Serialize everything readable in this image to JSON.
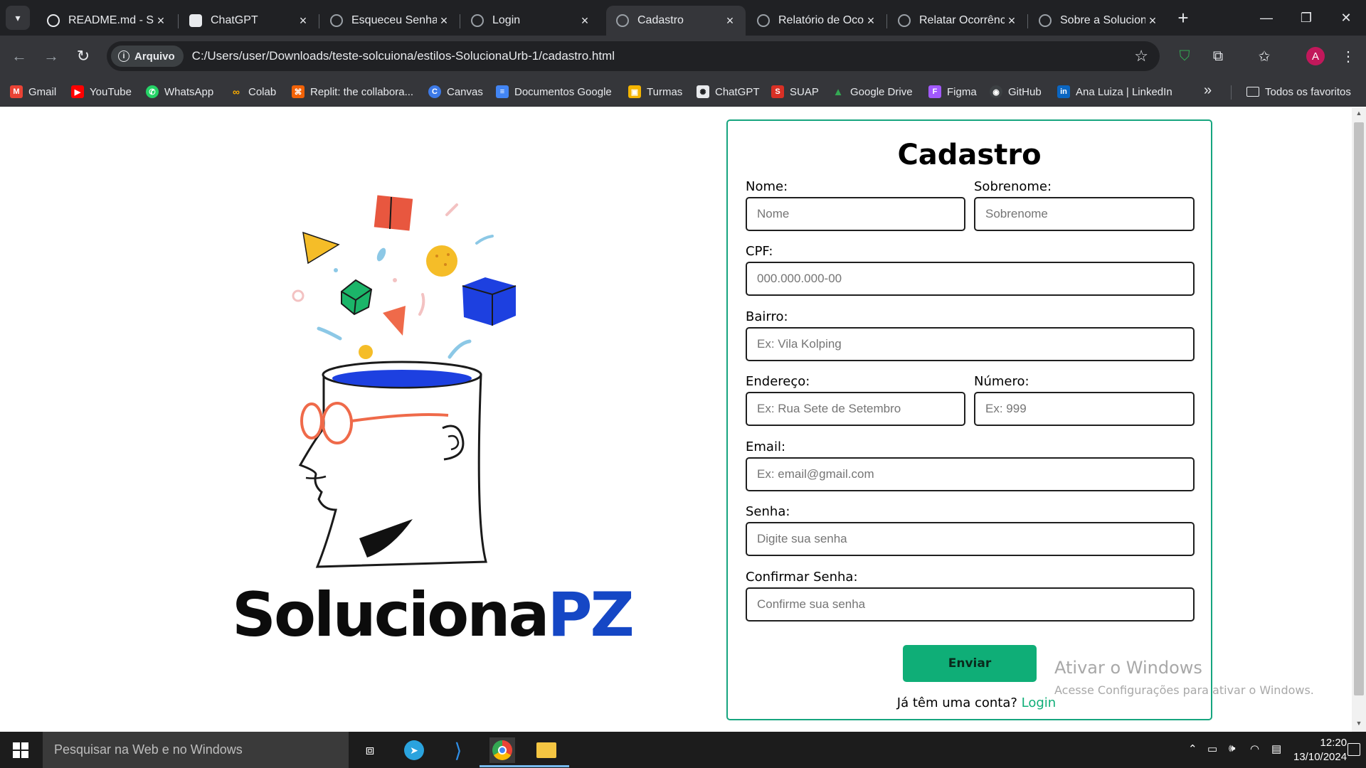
{
  "browser": {
    "tabs": [
      {
        "title": "README.md - Sc",
        "icon": "github-icon"
      },
      {
        "title": "ChatGPT",
        "icon": "chatgpt-icon"
      },
      {
        "title": "Esqueceu Senha",
        "icon": "globe-icon"
      },
      {
        "title": "Login",
        "icon": "globe-icon"
      },
      {
        "title": "Cadastro",
        "icon": "globe-icon",
        "active": true
      },
      {
        "title": "Relatório de Oco",
        "icon": "globe-icon"
      },
      {
        "title": "Relatar Ocorrênc",
        "icon": "globe-icon"
      },
      {
        "title": "Sobre a Solucion",
        "icon": "globe-icon"
      }
    ],
    "security_chip": "Arquivo",
    "url": "C:/Users/user/Downloads/teste-solcuiona/estilos-SolucionaUrb-1/cadastro.html",
    "profile_initial": "A",
    "bookmarks": [
      {
        "label": "Gmail",
        "icon": "gmail-icon",
        "color": "#ea4335"
      },
      {
        "label": "YouTube",
        "icon": "youtube-icon",
        "color": "#ff0000"
      },
      {
        "label": "WhatsApp",
        "icon": "whatsapp-icon",
        "color": "#25d366"
      },
      {
        "label": "Colab",
        "icon": "colab-icon",
        "color": "#f9ab00"
      },
      {
        "label": "Replit: the collabora...",
        "icon": "replit-icon",
        "color": "#f26207"
      },
      {
        "label": "Canvas",
        "icon": "canvas-icon",
        "color": "#3d7ae7"
      },
      {
        "label": "Documentos Google",
        "icon": "docs-icon",
        "color": "#4285f4"
      },
      {
        "label": "Turmas",
        "icon": "classroom-icon",
        "color": "#f4b400"
      },
      {
        "label": "ChatGPT",
        "icon": "chatgpt-icon",
        "color": "#e8eaed"
      },
      {
        "label": "SUAP",
        "icon": "suap-icon",
        "color": "#d93025"
      },
      {
        "label": "Google Drive",
        "icon": "drive-icon",
        "color": "#34a853"
      },
      {
        "label": "Figma",
        "icon": "figma-icon",
        "color": "#a259ff"
      },
      {
        "label": "GitHub",
        "icon": "github-icon",
        "color": "#9aa0a6"
      },
      {
        "label": "Ana Luiza | LinkedIn",
        "icon": "linkedin-icon",
        "color": "#0a66c2"
      }
    ],
    "all_bookmarks": "Todos os favoritos"
  },
  "page": {
    "brand_main": "Soluciona",
    "brand_accent": "PZ",
    "form": {
      "title": "Cadastro",
      "fields": {
        "nome": {
          "label": "Nome:",
          "placeholder": "Nome"
        },
        "sobrenome": {
          "label": "Sobrenome:",
          "placeholder": "Sobrenome"
        },
        "cpf": {
          "label": "CPF:",
          "placeholder": "000.000.000-00"
        },
        "bairro": {
          "label": "Bairro:",
          "placeholder": "Ex: Vila Kolping"
        },
        "endereco": {
          "label": "Endereço:",
          "placeholder": "Ex: Rua Sete de Setembro"
        },
        "numero": {
          "label": "Número:",
          "placeholder": "Ex: 999"
        },
        "email": {
          "label": "Email:",
          "placeholder": "Ex: email@gmail.com"
        },
        "senha": {
          "label": "Senha:",
          "placeholder": "Digite sua senha"
        },
        "confirmar": {
          "label": "Confirmar Senha:",
          "placeholder": "Confirme sua senha"
        }
      },
      "submit": "Enviar",
      "login_prompt": "Já têm uma conta?",
      "login_link": "Login"
    },
    "colors": {
      "accent": "#0fae77",
      "border": "#16a57f",
      "brand_blue": "#1547c5"
    }
  },
  "windows": {
    "activation_title": "Ativar o Windows",
    "activation_subtitle": "Acesse Configurações para ativar o Windows.",
    "search_placeholder": "Pesquisar na Web e no Windows",
    "time": "12:20",
    "date": "13/10/2024"
  }
}
